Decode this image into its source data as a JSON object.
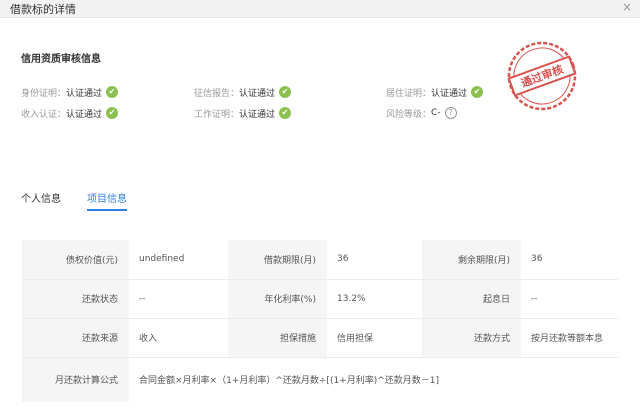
{
  "window": {
    "title": "借款标的详情",
    "close_label": "×"
  },
  "credit": {
    "section_title": "信用资质审核信息",
    "items": [
      {
        "label": "身份证明：",
        "value": "认证通过",
        "status": "verified"
      },
      {
        "label": "征信报告：",
        "value": "认证通过",
        "status": "verified"
      },
      {
        "label": "居住证明：",
        "value": "认证通过",
        "status": "verified"
      },
      {
        "label": "收入认证：",
        "value": "认证通过",
        "status": "verified"
      },
      {
        "label": "工作证明：",
        "value": "认证通过",
        "status": "verified"
      },
      {
        "label": "风险等级：",
        "value": "C-",
        "status": "help"
      }
    ],
    "stamp_text": "通过审核",
    "check_glyph": "✔",
    "help_glyph": "?",
    "colors": {
      "verified": "#8cc152",
      "stamp": "#d9534f",
      "accent": "#2f7fe8"
    }
  },
  "tabs": [
    {
      "label": "个人信息",
      "active": false
    },
    {
      "label": "项目信息",
      "active": true
    }
  ],
  "project": {
    "rows": [
      [
        {
          "k": "债权价值(元)",
          "v": "undefined"
        },
        {
          "k": "借款期限(月)",
          "v": "36"
        },
        {
          "k": "剩余期限(月)",
          "v": "36"
        }
      ],
      [
        {
          "k": "还款状态",
          "v": "--"
        },
        {
          "k": "年化利率(%)",
          "v": "13.2%"
        },
        {
          "k": "起息日",
          "v": "--"
        }
      ],
      [
        {
          "k": "还款来源",
          "v": "收入"
        },
        {
          "k": "担保措施",
          "v": "信用担保"
        },
        {
          "k": "还款方式",
          "v": "按月还款等额本息"
        }
      ]
    ],
    "formula": {
      "k": "月还款计算公式",
      "v": "合同金额×月利率×（1+月利率）^还款月数÷[(1+月利率)^还款月数－1]"
    }
  }
}
